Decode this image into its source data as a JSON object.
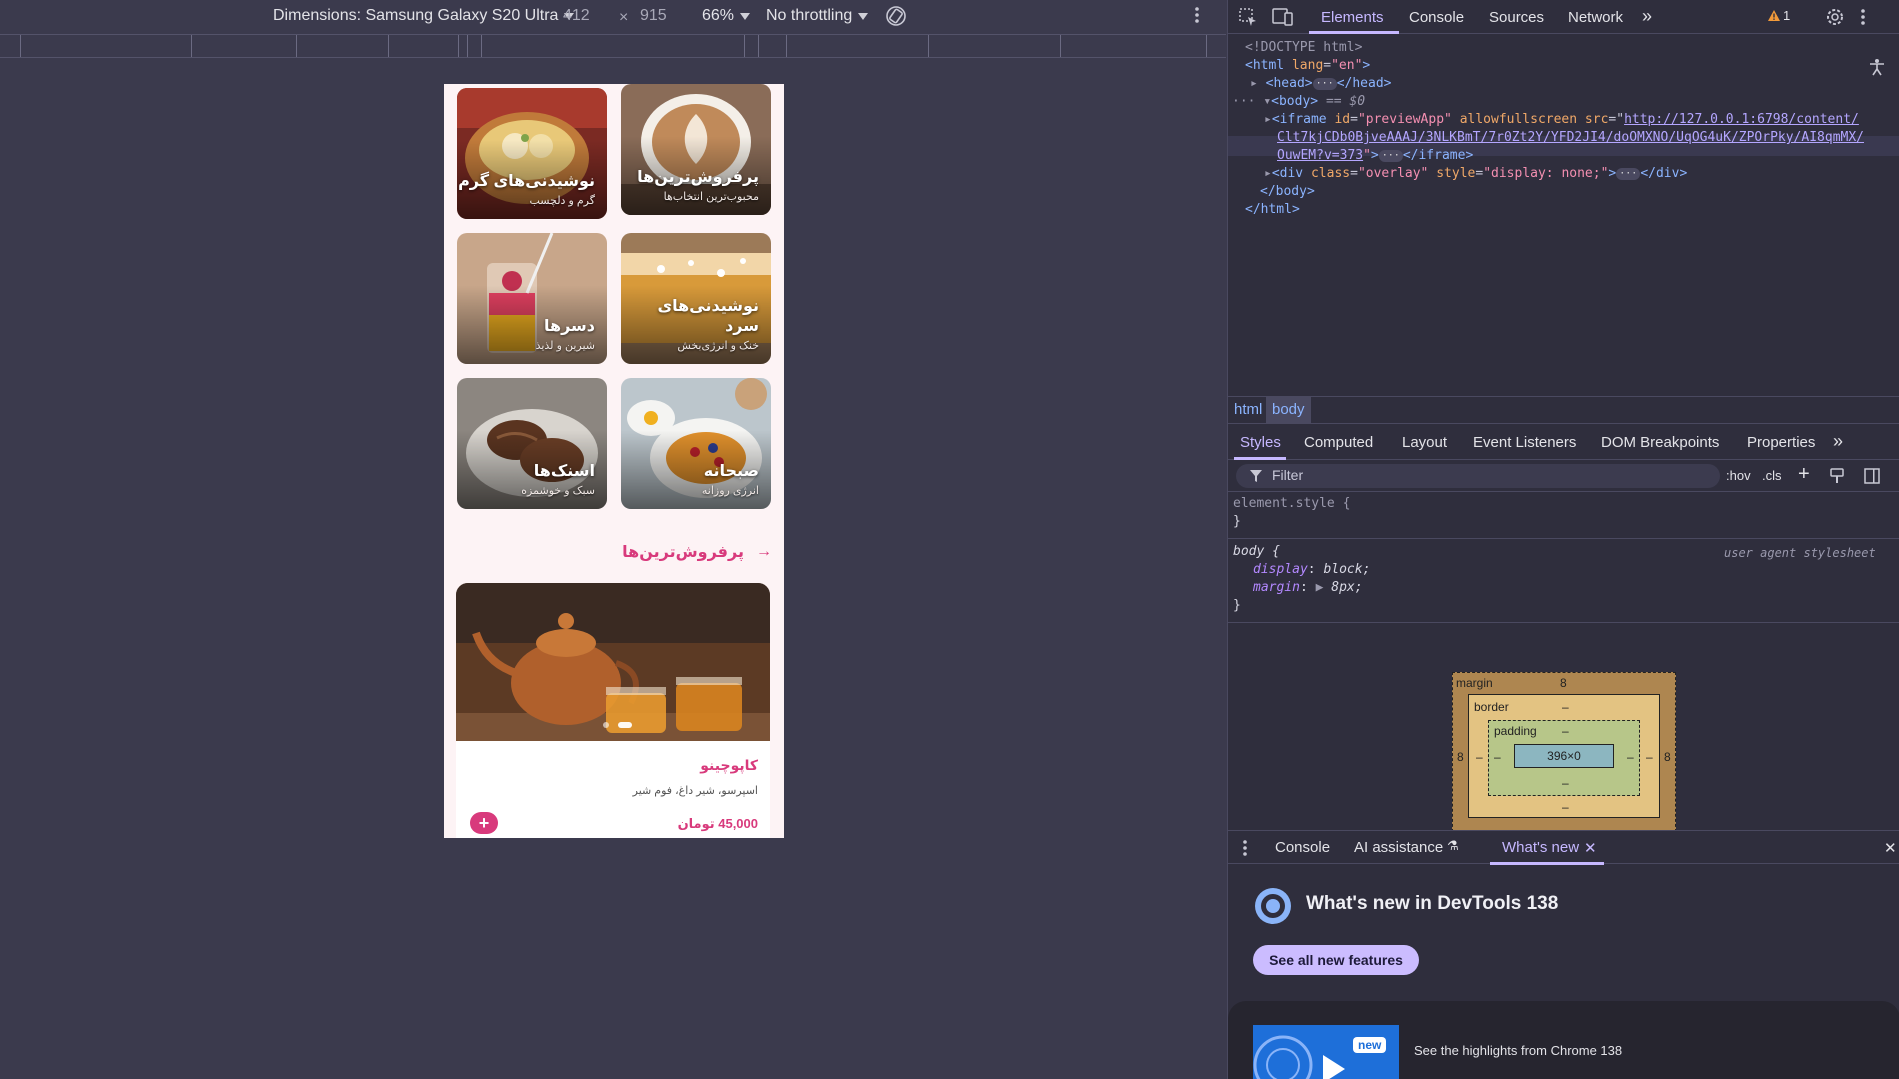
{
  "toolbar": {
    "dimensions_label": "Dimensions: Samsung Galaxy S20 Ultra",
    "width": "412",
    "times": "×",
    "height": "915",
    "zoom": "66%",
    "throttling": "No throttling"
  },
  "app": {
    "categories": [
      {
        "title": "پرفروش‌ترین‌ها",
        "subtitle": "محبوب‌ترین انتخاب‌ها"
      },
      {
        "title": "نوشیدنی‌های گرم",
        "subtitle": "گرم و دلچسب"
      },
      {
        "title": "نوشیدنی‌های سرد",
        "subtitle": "خنک و انرژی‌بخش"
      },
      {
        "title": "دسرها",
        "subtitle": "شیرین و لذیذ"
      },
      {
        "title": "صبحانه",
        "subtitle": "انرژی روزانه"
      },
      {
        "title": "اسنک‌ها",
        "subtitle": "سبک و خوشمزه"
      }
    ],
    "section_title": "پرفروش‌ترین‌ها",
    "section_arrow": "→",
    "product": {
      "name": "کاپوچینو",
      "description": "اسپرسو، شیر داغ، فوم شیر",
      "price": "45,000 تومان",
      "add": "+"
    },
    "accent": "#d83a7c"
  },
  "devtools": {
    "tabs": [
      "Elements",
      "Console",
      "Sources",
      "Network"
    ],
    "active_tab": "Elements",
    "warning_count": "1",
    "dom": {
      "doctype": "<!DOCTYPE html>",
      "html_open_tag": "html",
      "html_attr": "lang",
      "html_attr_val": "\"en\"",
      "head": "head",
      "body": "body",
      "body_marker": "== $0",
      "iframe_tag": "iframe",
      "iframe_id_attr": "id",
      "iframe_id_val": "\"previewApp\"",
      "iframe_allow": "allowfullscreen",
      "iframe_src_attr": "src",
      "iframe_src_1": "http://127.0.0.1:6798/content/",
      "iframe_src_2": "Clt7kjCDb0BjveAAAJ/3NLKBmT/7r0Zt2Y/YFD2JI4/doOMXNO/UqOG4uK/ZPOrPky/AI8qmMX/",
      "iframe_src_3": "OuwEM?v=373",
      "div_tag": "div",
      "div_class_attr": "class",
      "div_class_val": "\"overlay\"",
      "div_style_attr": "style",
      "div_style_val": "\"display: none;\"",
      "body_close": "</body>",
      "html_close": "</html>"
    },
    "breadcrumbs": [
      "html",
      "body"
    ],
    "styles_tabs": [
      "Styles",
      "Computed",
      "Layout",
      "Event Listeners",
      "DOM Breakpoints",
      "Properties"
    ],
    "filter_placeholder": "Filter",
    "hov": ":hov",
    "cls": ".cls",
    "styles": {
      "element_style": "element.style {",
      "close": "}",
      "body_rule": "body {",
      "ua": "user agent stylesheet",
      "display_prop": "display",
      "display_val": "block;",
      "margin_prop": "margin",
      "margin_val": "8px;"
    },
    "box_model": {
      "margin_label": "margin",
      "margin": "8",
      "border_label": "border",
      "padding_label": "padding",
      "dash": "–",
      "content": "396×0"
    },
    "drawer_tabs": [
      "Console",
      "AI assistance",
      "What's new"
    ],
    "whats_new": {
      "title": "What's new in DevTools 138",
      "button": "See all new features",
      "badge": "new",
      "highlight": "See the highlights from Chrome 138"
    }
  }
}
